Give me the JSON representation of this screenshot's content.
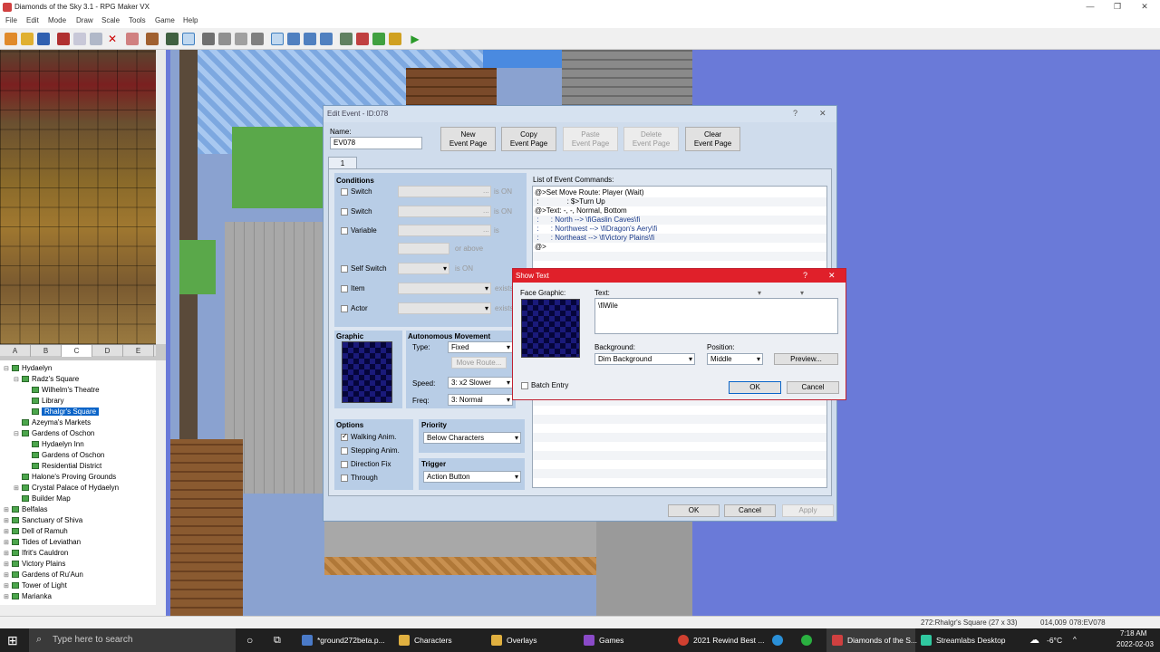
{
  "window": {
    "title": "Diamonds of the Sky 3.1 - RPG Maker VX"
  },
  "menu": [
    "File",
    "Edit",
    "Mode",
    "Draw",
    "Scale",
    "Tools",
    "Game",
    "Help"
  ],
  "tile_tabs": [
    "A",
    "B",
    "C",
    "D",
    "E"
  ],
  "tree": [
    {
      "label": "Hydaelyn",
      "indent": 0,
      "exp": "⊟"
    },
    {
      "label": "Radz's Square",
      "indent": 1,
      "exp": "⊟"
    },
    {
      "label": "Wilhelm's Theatre",
      "indent": 2,
      "exp": ""
    },
    {
      "label": "Library",
      "indent": 2,
      "exp": ""
    },
    {
      "label": "Rhalgr's Square",
      "indent": 2,
      "exp": "",
      "sel": true
    },
    {
      "label": "Azeyma's Markets",
      "indent": 1,
      "exp": ""
    },
    {
      "label": "Gardens of Oschon",
      "indent": 1,
      "exp": "⊟"
    },
    {
      "label": "Hydaelyn Inn",
      "indent": 2,
      "exp": ""
    },
    {
      "label": "Gardens of Oschon",
      "indent": 2,
      "exp": ""
    },
    {
      "label": "Residential District",
      "indent": 2,
      "exp": ""
    },
    {
      "label": "Halone's Proving Grounds",
      "indent": 1,
      "exp": ""
    },
    {
      "label": "Crystal Palace of Hydaelyn",
      "indent": 1,
      "exp": "⊞"
    },
    {
      "label": "Builder Map",
      "indent": 1,
      "exp": ""
    },
    {
      "label": "Belfalas",
      "indent": 0,
      "exp": "⊞"
    },
    {
      "label": "Sanctuary of Shiva",
      "indent": 0,
      "exp": "⊞"
    },
    {
      "label": "Dell of Ramuh",
      "indent": 0,
      "exp": "⊞"
    },
    {
      "label": "Tides of Leviathan",
      "indent": 0,
      "exp": "⊞"
    },
    {
      "label": "Ifrit's Cauldron",
      "indent": 0,
      "exp": "⊞"
    },
    {
      "label": "Victory Plains",
      "indent": 0,
      "exp": "⊞"
    },
    {
      "label": "Gardens of Ru'Aun",
      "indent": 0,
      "exp": "⊞"
    },
    {
      "label": "Tower of Light",
      "indent": 0,
      "exp": "⊞"
    },
    {
      "label": "Marianka",
      "indent": 0,
      "exp": "⊞"
    }
  ],
  "edit_event": {
    "title": "Edit Event - ID:078",
    "help": "?",
    "close": "✕",
    "name_label": "Name:",
    "name_value": "EV078",
    "new_page": "New\nEvent Page",
    "copy_page": "Copy\nEvent Page",
    "paste_page": "Paste\nEvent Page",
    "delete_page": "Delete\nEvent Page",
    "clear_page": "Clear\nEvent Page",
    "tab": "1",
    "conditions_label": "Conditions",
    "cond_switch": "Switch",
    "cond_switch2": "Switch",
    "cond_variable": "Variable",
    "cond_self_switch": "Self Switch",
    "cond_item": "Item",
    "cond_actor": "Actor",
    "is_on": "is ON",
    "is_on2": "is ON",
    "is": "is",
    "or_above": "or above",
    "is_on3": "is ON",
    "exists": "exists",
    "exists2": "exists",
    "ellipsis": "...",
    "graphic_label": "Graphic",
    "auto_label": "Autonomous Movement",
    "type_label": "Type:",
    "type_value": "Fixed",
    "move_route": "Move Route...",
    "speed_label": "Speed:",
    "speed_value": "3: x2 Slower",
    "freq_label": "Freq:",
    "freq_value": "3: Normal",
    "options_label": "Options",
    "opt_walking": "Walking Anim.",
    "opt_stepping": "Stepping Anim.",
    "opt_direction": "Direction Fix",
    "opt_through": "Through",
    "priority_label": "Priority",
    "priority_value": "Below Characters",
    "trigger_label": "Trigger",
    "trigger_value": "Action Button",
    "list_label": "List of Event Commands:",
    "commands": [
      "@>Set Move Route: Player (Wait)",
      " :              : $>Turn Up",
      "@>Text: -, -, Normal, Bottom",
      " :      : North --> \\fiGaslin Caves\\fi",
      " :      : Northwest --> \\fiDragon's Aery\\fi",
      " :      : Northeast --> \\fiVictory Plains\\fi",
      "@>"
    ],
    "ok": "OK",
    "cancel": "Cancel",
    "apply": "Apply"
  },
  "show_text": {
    "title": "Show Text",
    "help": "?",
    "close": "✕",
    "face_label": "Face Graphic:",
    "text_label": "Text:",
    "text_value": "\\fiWile",
    "bg_label": "Background:",
    "bg_value": "Dim Background",
    "pos_label": "Position:",
    "pos_value": "Middle",
    "preview": "Preview...",
    "batch": "Batch Entry",
    "ok": "OK",
    "cancel": "Cancel"
  },
  "status": {
    "map": "272:Rhalgr's Square (27 x 33)",
    "coords": "014,009",
    "event": "078:EV078"
  },
  "taskbar": {
    "search": "Type here to search",
    "tasks": [
      "*ground272beta.p...",
      "Characters",
      "Overlays",
      "Games",
      "2021 Rewind Best ...",
      "Diamonds of the S...",
      "Streamlabs Desktop"
    ],
    "temp": "-6°C",
    "time": "7:18 AM",
    "date": "2022-02-03"
  }
}
